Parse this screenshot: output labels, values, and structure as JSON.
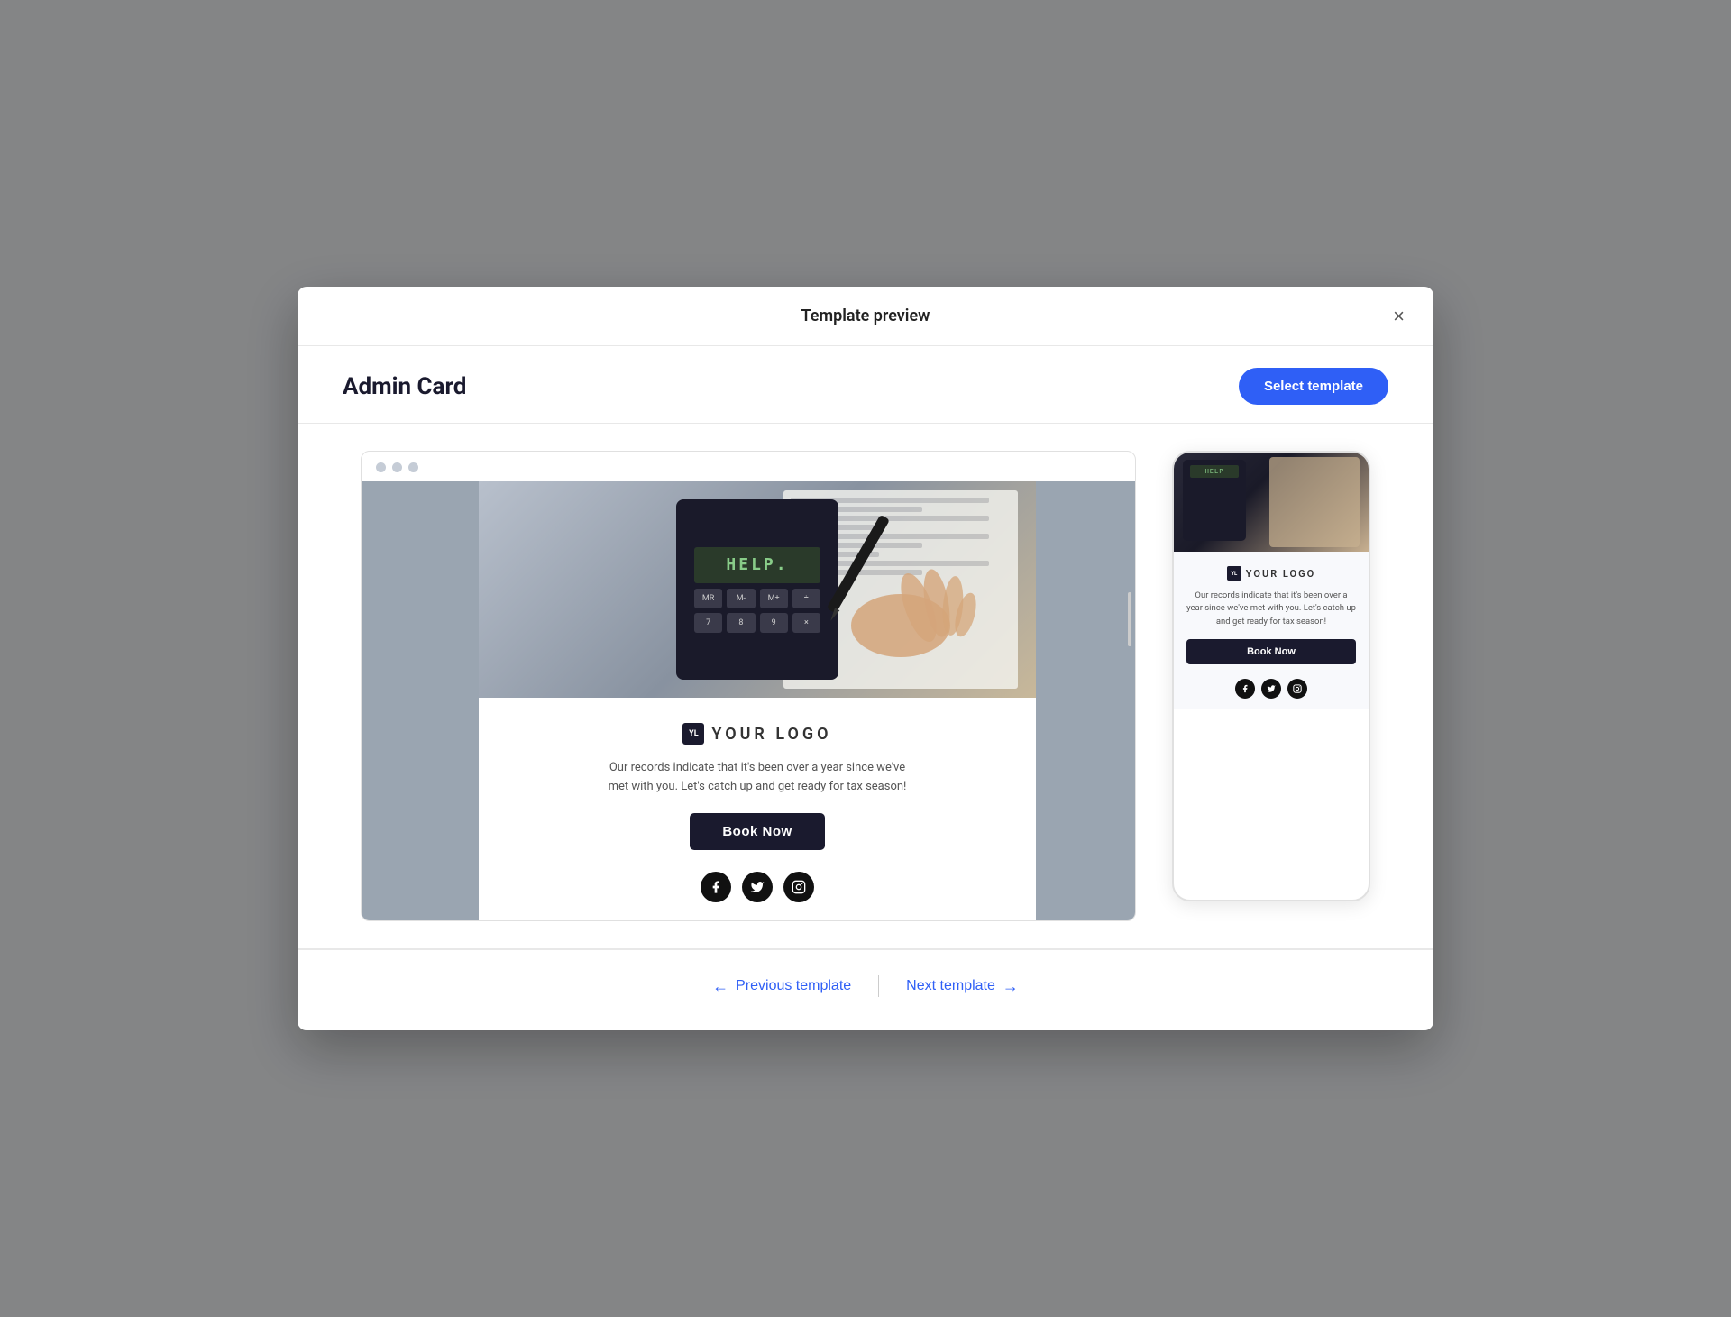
{
  "modal": {
    "title": "Template preview",
    "close_label": "×"
  },
  "header": {
    "template_name": "Admin Card",
    "select_button_label": "Select template"
  },
  "browser_dots": [
    "dot1",
    "dot2",
    "dot3"
  ],
  "email": {
    "logo_badge": "YL",
    "logo_text": "YOUR LOGO",
    "body_text": "Our records indicate that it's been over a year since we've met with you. Let's catch up and get ready for tax season!",
    "book_button_label": "Book Now",
    "calc_display": "HELP.",
    "social_icons": [
      "facebook",
      "twitter",
      "instagram"
    ]
  },
  "mobile": {
    "logo_badge": "YL",
    "logo_text": "YOUR LOGO",
    "body_text": "Our records indicate that it's been over a year since we've met with you. Let's catch up and get ready for tax season!",
    "book_button_label": "Book Now",
    "calc_display": "HELP"
  },
  "footer": {
    "prev_label": "Previous template",
    "next_label": "Next template",
    "prev_arrow": "←",
    "next_arrow": "→"
  },
  "colors": {
    "accent": "#2f5ff6",
    "dark": "#1a1a2e",
    "sidebar_gray": "#9aa5b1"
  }
}
